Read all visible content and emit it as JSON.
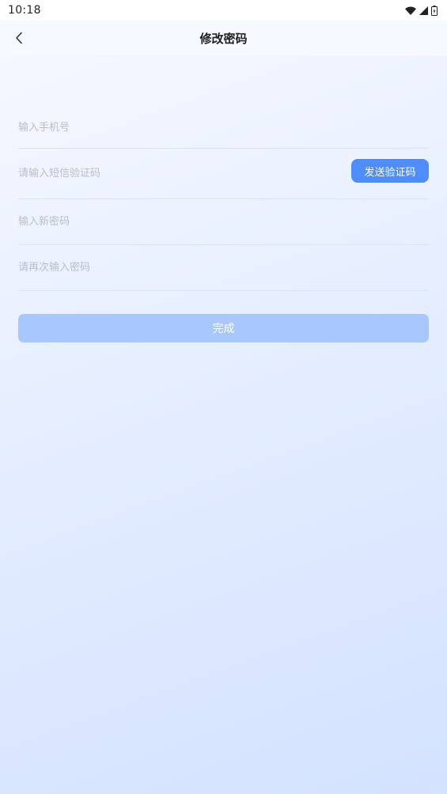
{
  "status_bar": {
    "time": "10:18",
    "icons": [
      "wifi-icon",
      "signal-icon",
      "battery-icon"
    ]
  },
  "header": {
    "back_icon": "chevron-left-icon",
    "title": "修改密码"
  },
  "form": {
    "phone": {
      "value": "",
      "placeholder": "输入手机号"
    },
    "sms_code": {
      "value": "",
      "placeholder": "请输入短信验证码"
    },
    "send_code_label": "发送验证码",
    "new_password": {
      "value": "",
      "placeholder": "输入新密码"
    },
    "confirm_password": {
      "value": "",
      "placeholder": "请再次输入密码"
    },
    "submit_label": "完成"
  },
  "colors": {
    "accent": "#4f8dfb",
    "submit_disabled": "#a8c8fd",
    "placeholder": "#b9bec8",
    "divider": "#dde3ee"
  }
}
